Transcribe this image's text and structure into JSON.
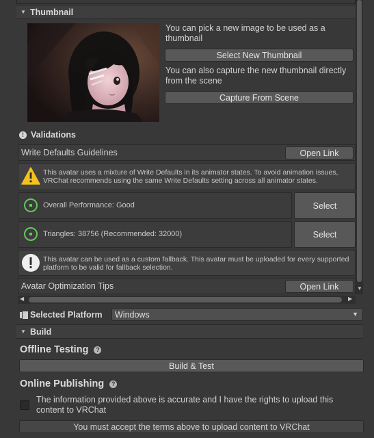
{
  "thumbnail": {
    "title": "Thumbnail",
    "pick_text": "You can pick a new image to be used as a thumbnail",
    "select_new_button": "Select New Thumbnail",
    "capture_text": "You can also capture the new thumbnail directly from the scene",
    "capture_button": "Capture From Scene"
  },
  "validations": {
    "title": "Validations",
    "write_defaults": {
      "label": "Write Defaults Guidelines",
      "button": "Open Link"
    },
    "write_defaults_warning": "This avatar uses a mixture of Write Defaults in its animator states. To avoid animation issues, VRChat recommends using the same Write Defaults setting across all animator states.",
    "performance": {
      "label": "Overall Performance: Good",
      "button": "Select"
    },
    "triangles": {
      "label": "Triangles: 38756 (Recommended: 32000)",
      "button": "Select"
    },
    "fallback_info": "This avatar can be used as a custom fallback. This avatar must be uploaded for every supported platform to be valid for fallback selection.",
    "optimization": {
      "label": "Avatar Optimization Tips",
      "button": "Open Link"
    }
  },
  "platform": {
    "label": "Selected Platform",
    "value": "Windows"
  },
  "build": {
    "title": "Build",
    "offline_label": "Offline Testing",
    "build_test_button": "Build & Test",
    "online_label": "Online Publishing",
    "terms_text": "The information provided above is accurate and I have the rights to upload this content to VRChat",
    "terms_checked": false,
    "upload_button": "You must accept the terms above to upload content to VRChat"
  },
  "colors": {
    "background": "#383838",
    "button": "#585858",
    "performance_good": "#64c85a",
    "warning": "#f4c21c"
  }
}
